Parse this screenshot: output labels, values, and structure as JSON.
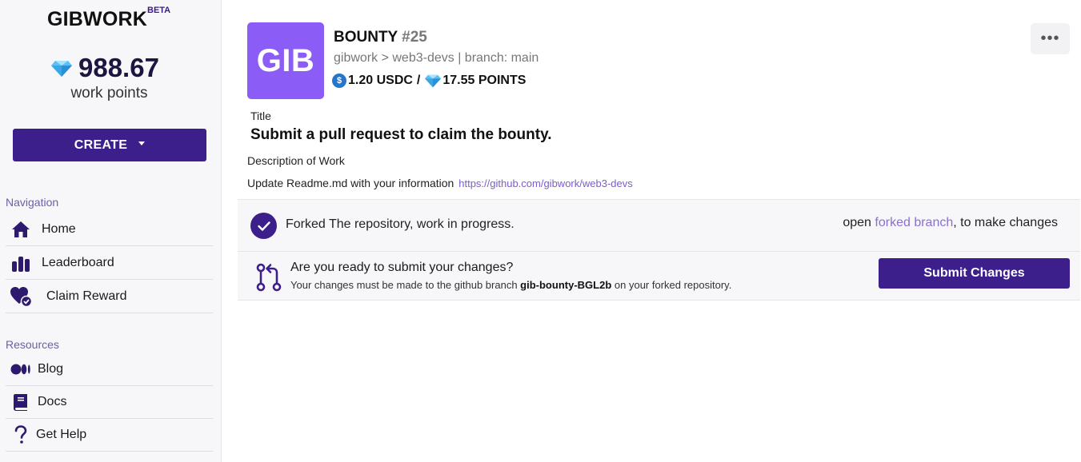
{
  "brand": {
    "name": "GIBWORK",
    "badge": "BETA"
  },
  "points": {
    "value": "988.67",
    "label": "work points"
  },
  "create_button": {
    "label": "CREATE"
  },
  "navigation": {
    "heading": "Navigation",
    "items": [
      {
        "label": "Home",
        "icon": "home-icon"
      },
      {
        "label": "Leaderboard",
        "icon": "bar-chart-icon"
      },
      {
        "label": "Claim Reward",
        "icon": "heart-check-icon"
      }
    ]
  },
  "resources": {
    "heading": "Resources",
    "items": [
      {
        "label": "Blog",
        "icon": "medium-icon"
      },
      {
        "label": "Docs",
        "icon": "book-icon"
      },
      {
        "label": "Get Help",
        "icon": "question-icon"
      }
    ]
  },
  "bounty": {
    "logo_text": "GIB",
    "title": "BOUNTY",
    "number": "#25",
    "repo_line": "gibwork > web3-devs | branch: main",
    "usdc_amount": "1.20 USDC",
    "separator": "/",
    "points_amount": "17.55 POINTS",
    "more_label": "•••"
  },
  "task": {
    "title_label": "Title",
    "title": "Submit a pull request to claim the bounty.",
    "description_label": "Description of Work",
    "description": "Update Readme.md with your information",
    "link": "https://github.com/gibwork/web3-devs"
  },
  "status": {
    "text": "Forked The repository, work in progress.",
    "open_prefix": "open",
    "open_link": "forked branch",
    "open_suffix": ", to make changes"
  },
  "submit": {
    "question": "Are you ready to submit your changes?",
    "note_prefix": "Your changes must be made to the github branch",
    "branch": "gib-bounty-BGL2b",
    "note_suffix": "on your forked repository.",
    "button_label": "Submit Changes"
  },
  "colors": {
    "primary": "#3d1f8c",
    "logo_tile": "#8b5cf6",
    "link": "#7c5bd1",
    "usdc": "#2775ca"
  }
}
